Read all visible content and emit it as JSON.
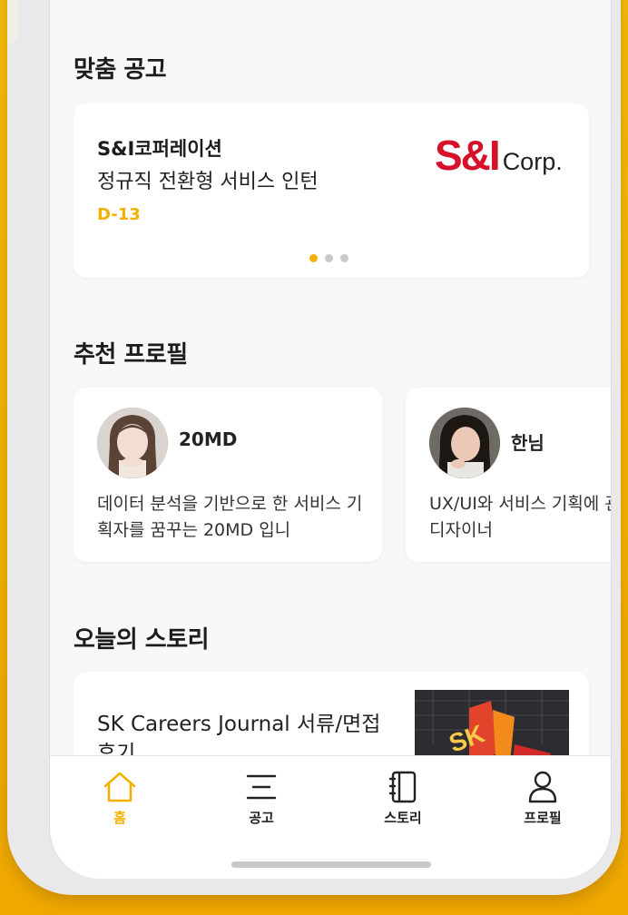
{
  "sections": {
    "jobs_title": "맞춤 공고",
    "profiles_title": "추천 프로필",
    "story_title": "오늘의 스토리"
  },
  "job": {
    "company": "S&I코퍼레이션",
    "title": "정규직 전환형 서비스 인턴",
    "dday": "D-13",
    "logo_mark": "S&I",
    "logo_suffix": "Corp.",
    "carousel": {
      "count": 3,
      "active": 0
    }
  },
  "profiles": [
    {
      "name": "20MD",
      "desc": "데이터 분석을 기반으로 한 서비스 기획자를 꿈꾸는 20MD 입니"
    },
    {
      "name": "한님",
      "desc": "UX/UI와 서비스 기획에 관심이 많은 디자이너"
    }
  ],
  "story": {
    "title": "SK Careers Journal 서류/면접 후기",
    "thumb_text": "SK"
  },
  "tabbar": {
    "home": "홈",
    "jobs": "공고",
    "story": "스토리",
    "profile": "프로필",
    "active": "home"
  },
  "colors": {
    "accent": "#f2b100",
    "logo_red": "#d6112a",
    "background": "#f7b500"
  },
  "icons": [
    "home-icon",
    "menu-lines-icon",
    "notebook-icon",
    "person-icon"
  ]
}
